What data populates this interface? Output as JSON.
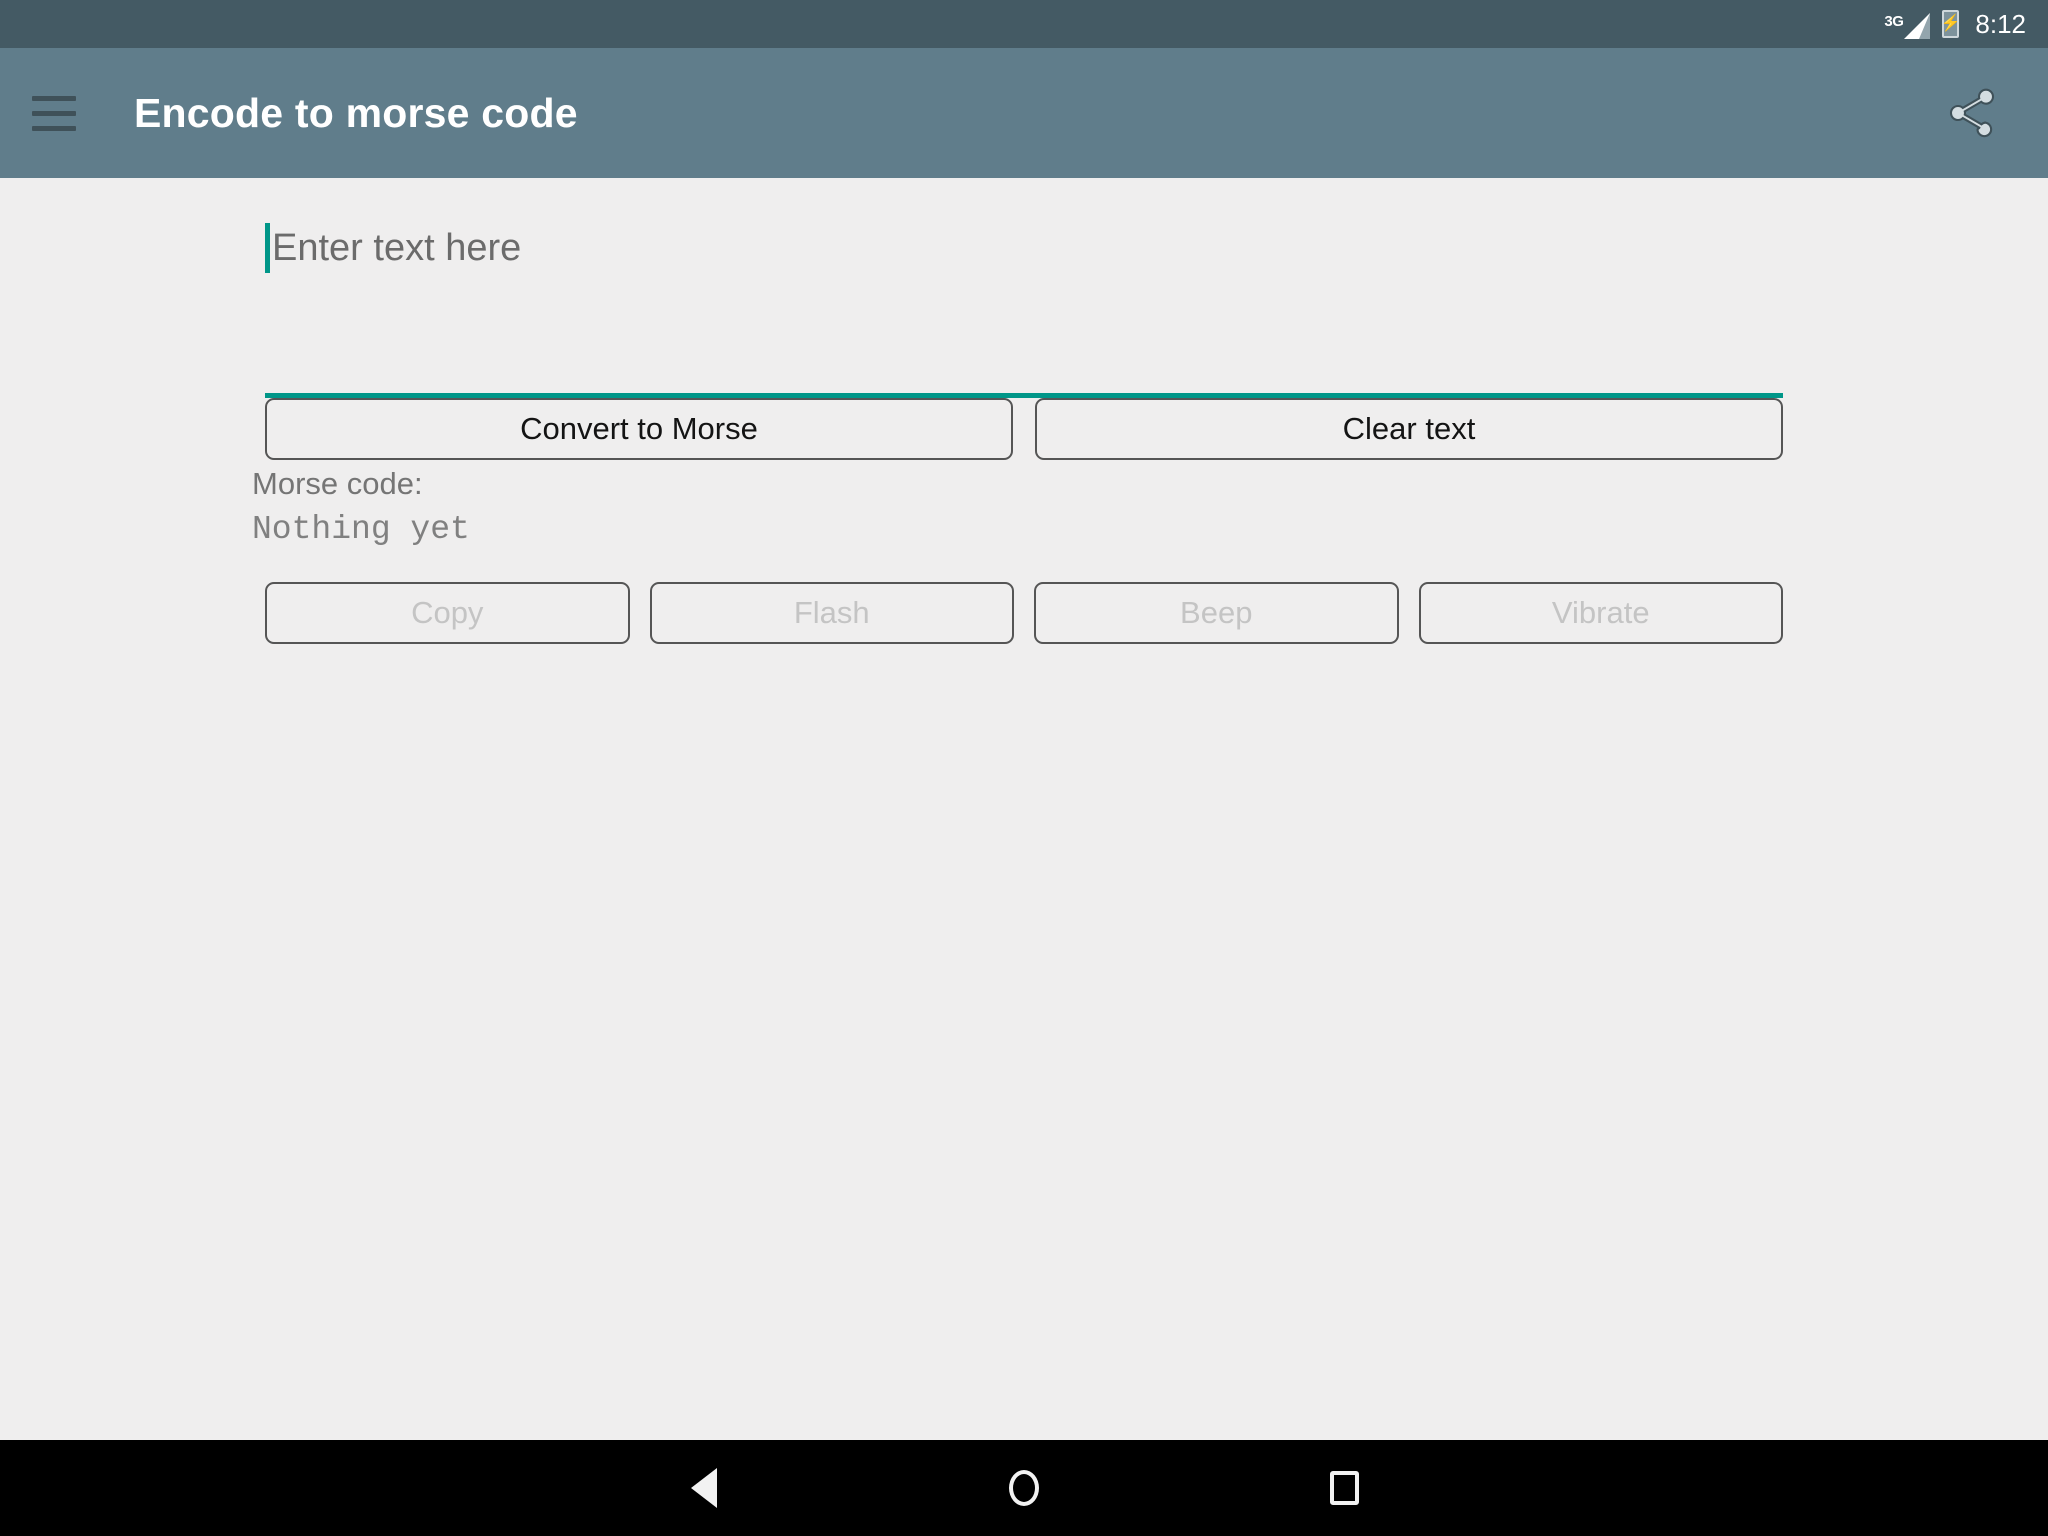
{
  "status_bar": {
    "network_label": "3G",
    "signal_icon": "signal-bars-icon",
    "battery_icon": "battery-charging-icon",
    "time": "8:12"
  },
  "app_bar": {
    "menu_icon": "hamburger-menu-icon",
    "title": "Encode to morse code",
    "share_icon": "share-icon",
    "background_color": "#607d8b"
  },
  "input": {
    "placeholder": "Enter text here",
    "value": "",
    "accent_color": "#009688"
  },
  "primary_actions": [
    {
      "label": "Convert to Morse",
      "name": "convert-to-morse-button",
      "enabled": true
    },
    {
      "label": "Clear text",
      "name": "clear-text-button",
      "enabled": true
    }
  ],
  "output": {
    "label": "Morse code:",
    "value": "Nothing yet"
  },
  "secondary_actions": [
    {
      "label": "Copy",
      "name": "copy-button",
      "enabled": false
    },
    {
      "label": "Flash",
      "name": "flash-button",
      "enabled": false
    },
    {
      "label": "Beep",
      "name": "beep-button",
      "enabled": false
    },
    {
      "label": "Vibrate",
      "name": "vibrate-button",
      "enabled": false
    }
  ],
  "nav_bar": {
    "back_icon": "back-triangle-icon",
    "home_icon": "home-circle-icon",
    "recents_icon": "recents-square-icon"
  }
}
